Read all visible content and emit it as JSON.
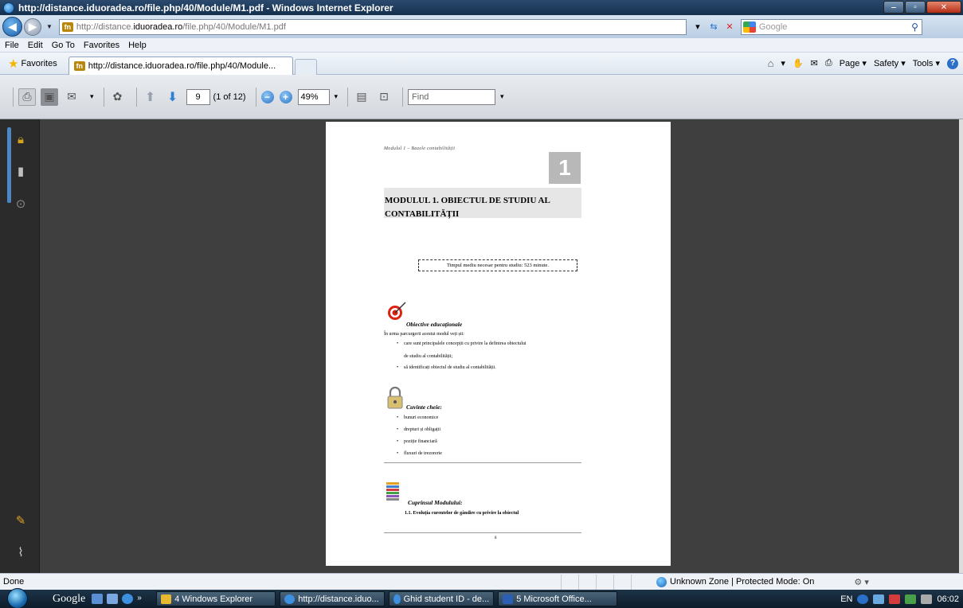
{
  "window": {
    "title": "http://distance.iduoradea.ro/file.php/40/Module/M1.pdf - Windows Internet Explorer"
  },
  "address": {
    "prefix": "http://distance.",
    "domain": "iduoradea.ro",
    "path": "/file.php/40/Module/M1.pdf",
    "search_placeholder": "Google"
  },
  "menu": [
    "File",
    "Edit",
    "Go To",
    "Favorites",
    "Help"
  ],
  "favorites": {
    "label": "Favorites",
    "tab_title": "http://distance.iduoradea.ro/file.php/40/Module...",
    "commands": [
      "Page ▾",
      "Safety ▾",
      "Tools ▾"
    ]
  },
  "pdf_toolbar": {
    "page": "9",
    "page_count": "(1 of 12)",
    "zoom": "49%",
    "find_placeholder": "Find"
  },
  "document": {
    "header": "Modulul 1 – Bazele contabilității",
    "number": "1",
    "title_line1": "MODULUL 1. OBIECTUL DE STUDIU AL",
    "title_line2": "CONTABILITĂȚII",
    "time_text": "Timpul mediu necesar pentru studiu: 523 minute.",
    "objectives_title": "Obiective educaționale",
    "objectives_intro": "În urma parcurgerii acestui modul veți ști:",
    "objective_1a": "care sunt principalele concepții cu privire la definirea obiectului",
    "objective_1b": "de studiu al contabilității;",
    "objective_2": "să identificați obiectul de studiu al contabilității.",
    "keywords_title": "Cuvinte cheie:",
    "keywords": [
      "bunuri economice",
      "drepturi și obligații",
      "poziție financiară",
      "fluxuri de trezorerie"
    ],
    "contents_title": "Cuprinsul Modulului:",
    "contents_item": "1.1. Evoluția curentelor de gândire cu privire la obiectul",
    "page_footer": "8"
  },
  "status": {
    "text": "Done",
    "zone": "Unknown Zone | Protected Mode: On"
  },
  "taskbar": {
    "google": "Google",
    "items": [
      "4 Windows Explorer",
      "http://distance.iduo...",
      "Ghid student ID - de...",
      "5 Microsoft Office..."
    ],
    "lang": "EN",
    "time": "06:02"
  },
  "colors": {
    "viewer_bg": "#3f3f3f",
    "title_bar": "#1e3a5c",
    "accent_blue": "#2f7fd3"
  }
}
